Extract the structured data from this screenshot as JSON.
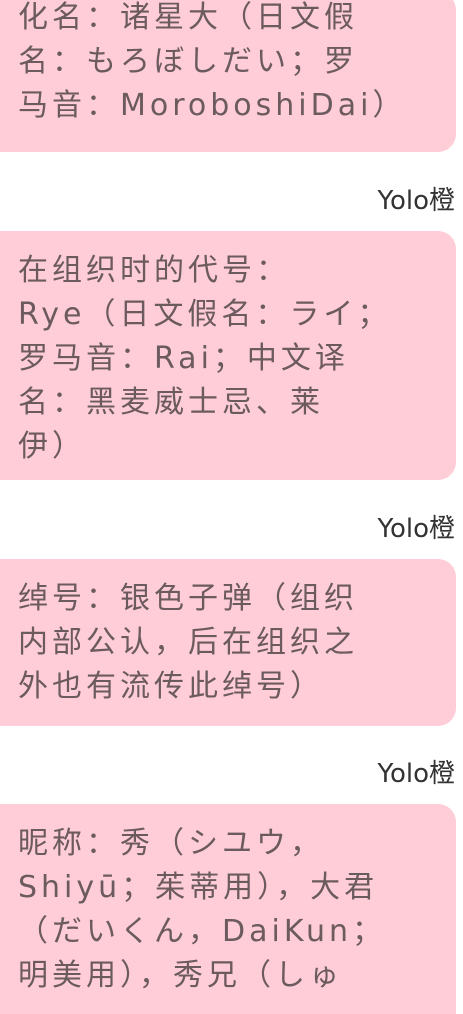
{
  "messages": [
    {
      "id": 1,
      "text": "化名：诸星大（日文假\n名：もろぼしだい；罗\n马音：MoroboshiDai）"
    },
    {
      "id": 2,
      "sender": "Yolo橙",
      "text": "在组织时的代号：\nRye（日文假名：ライ；\n罗马音：Rai；中文译\n名：黑麦威士忌、莱\n伊）"
    },
    {
      "id": 3,
      "sender": "Yolo橙",
      "text": "绰号：银色子弹（组织\n内部公认，后在组织之\n外也有流传此绰号）"
    },
    {
      "id": 4,
      "sender": "Yolo橙",
      "text": "昵称：秀（シユウ，\nShiyū；茱蒂用），大君\n（だいくん，DaiKun；\n明美用），秀兄（しゅ"
    }
  ],
  "colors": {
    "bubble_background": "#ffcdd7",
    "bubble_text": "#6b5a5e",
    "sender_text": "#333333",
    "page_background": "#ffffff"
  }
}
